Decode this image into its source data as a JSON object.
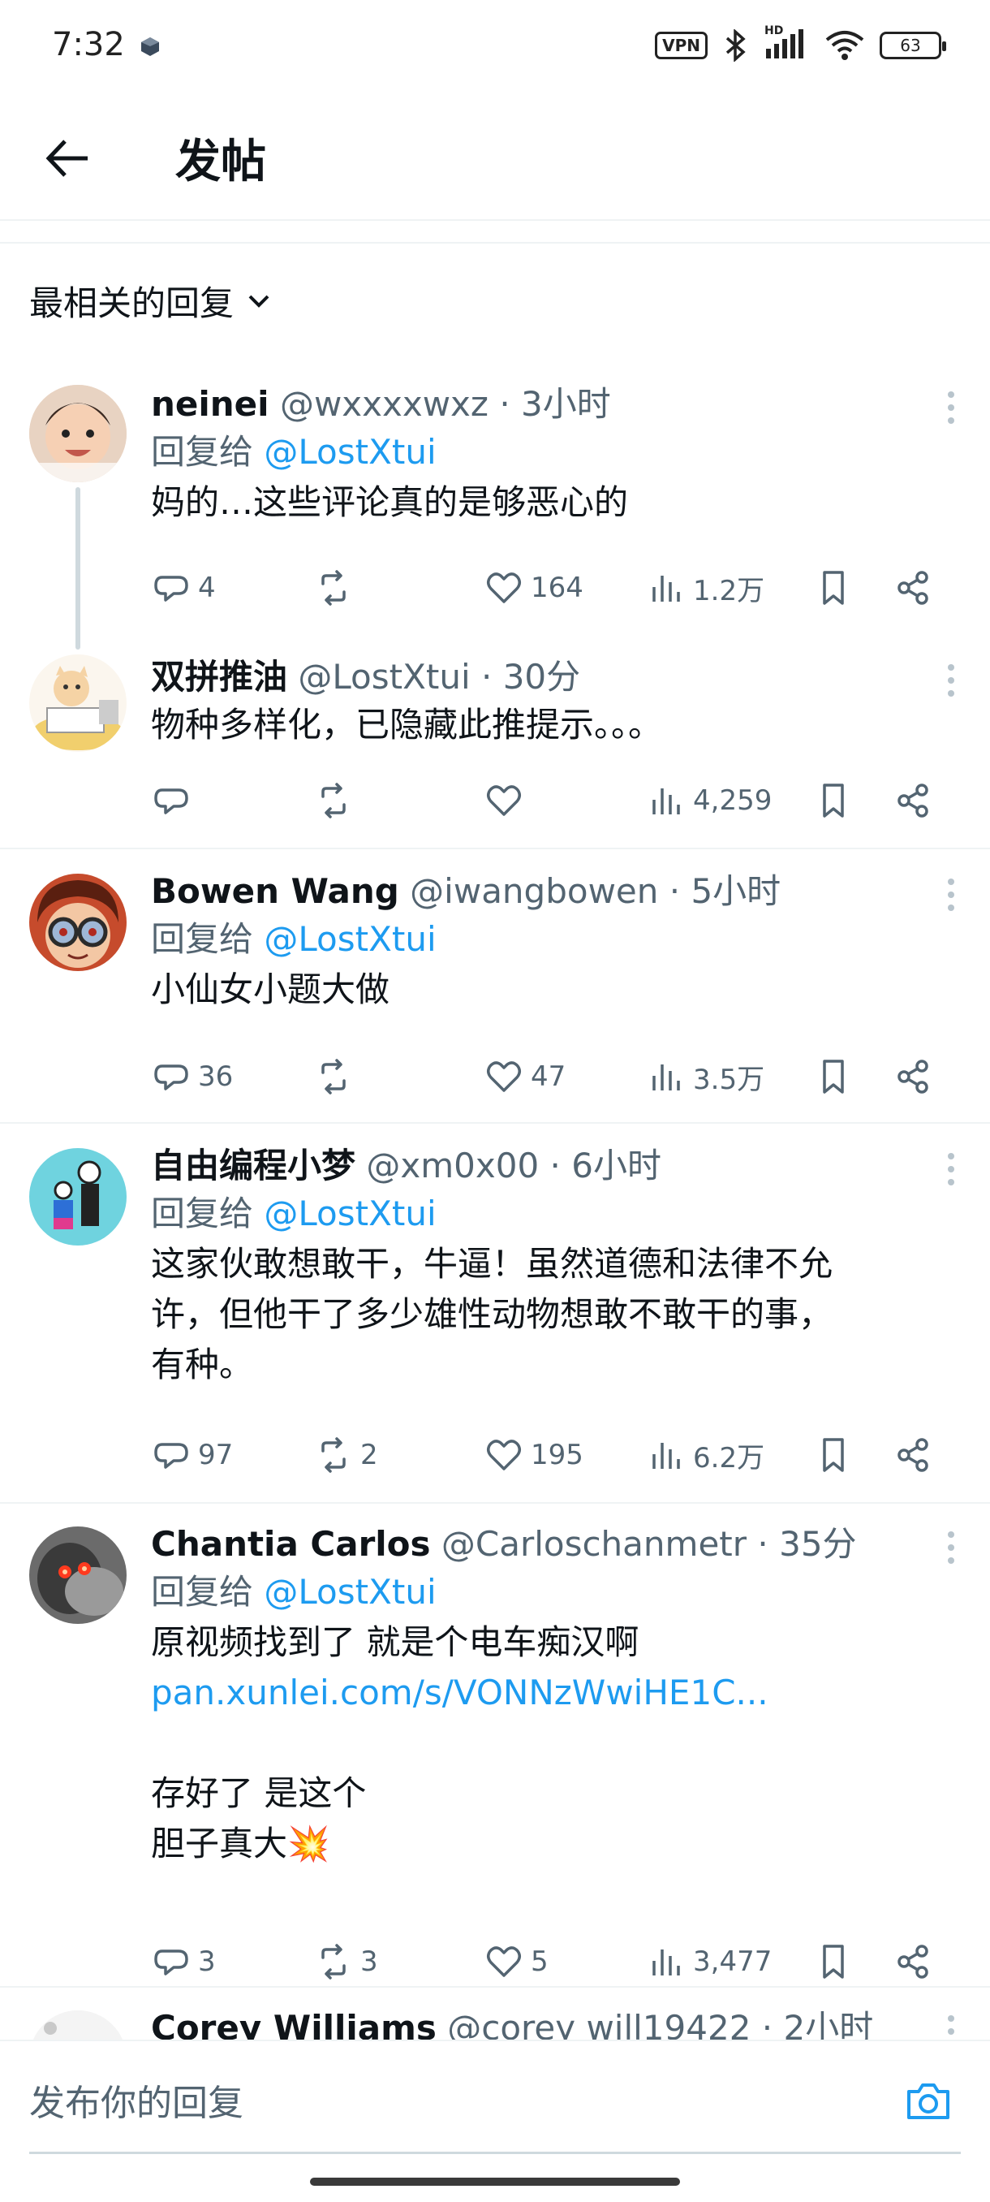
{
  "status_bar": {
    "time": "7:32",
    "vpn": "VPN",
    "signal_label": "HD",
    "battery": "63"
  },
  "header": {
    "title": "发帖"
  },
  "sort": {
    "label": "最相关的回复"
  },
  "colors": {
    "accent": "#1d9bf0",
    "secondary_text": "#536471",
    "thread_line": "#cfd9de"
  },
  "tweets": [
    {
      "name": "neinei",
      "handle": "@wxxxxwxz",
      "time": "3小时",
      "reply_prefix": "回复给",
      "reply_to": "@LostXtui",
      "text": "妈的…这些评论真的是够恶心的",
      "replies": "4",
      "retweets": "",
      "likes": "164",
      "views": "1.2万"
    },
    {
      "name": "双拼推油",
      "handle": "@LostXtui",
      "time": "30分",
      "text": "物种多样化，已隐藏此推提示。。。",
      "replies": "",
      "retweets": "",
      "likes": "",
      "views": "4,259"
    },
    {
      "name": "Bowen Wang",
      "handle": "@iwangbowen",
      "time": "5小时",
      "reply_prefix": "回复给",
      "reply_to": "@LostXtui",
      "text": "小仙女小题大做",
      "replies": "36",
      "retweets": "",
      "likes": "47",
      "views": "3.5万"
    },
    {
      "name": "自由编程小梦",
      "handle": "@xm0x00",
      "time": "6小时",
      "reply_prefix": "回复给",
      "reply_to": "@LostXtui",
      "text": "这家伙敢想敢干，牛逼！虽然道德和法律不允\n许，但他干了多少雄性动物想敢不敢干的事，\n有种。",
      "replies": "97",
      "retweets": "2",
      "likes": "195",
      "views": "6.2万"
    },
    {
      "name": "Chantia Carlos",
      "handle": "@Carloschanmetr",
      "time": "35分",
      "reply_prefix": "回复给",
      "reply_to": "@LostXtui",
      "text_before": "原视频找到了 就是个电车痴汉啊",
      "link": "pan.xunlei.com/s/VONNzWwiHE1C...",
      "text_after": "存好了 是这个\n胆子真大💥",
      "replies": "3",
      "retweets": "3",
      "likes": "5",
      "views": "3,477"
    },
    {
      "name": "Corey Williams",
      "handle": "@corey will19422",
      "time": "2小时"
    }
  ],
  "composer": {
    "placeholder": "发布你的回复"
  }
}
